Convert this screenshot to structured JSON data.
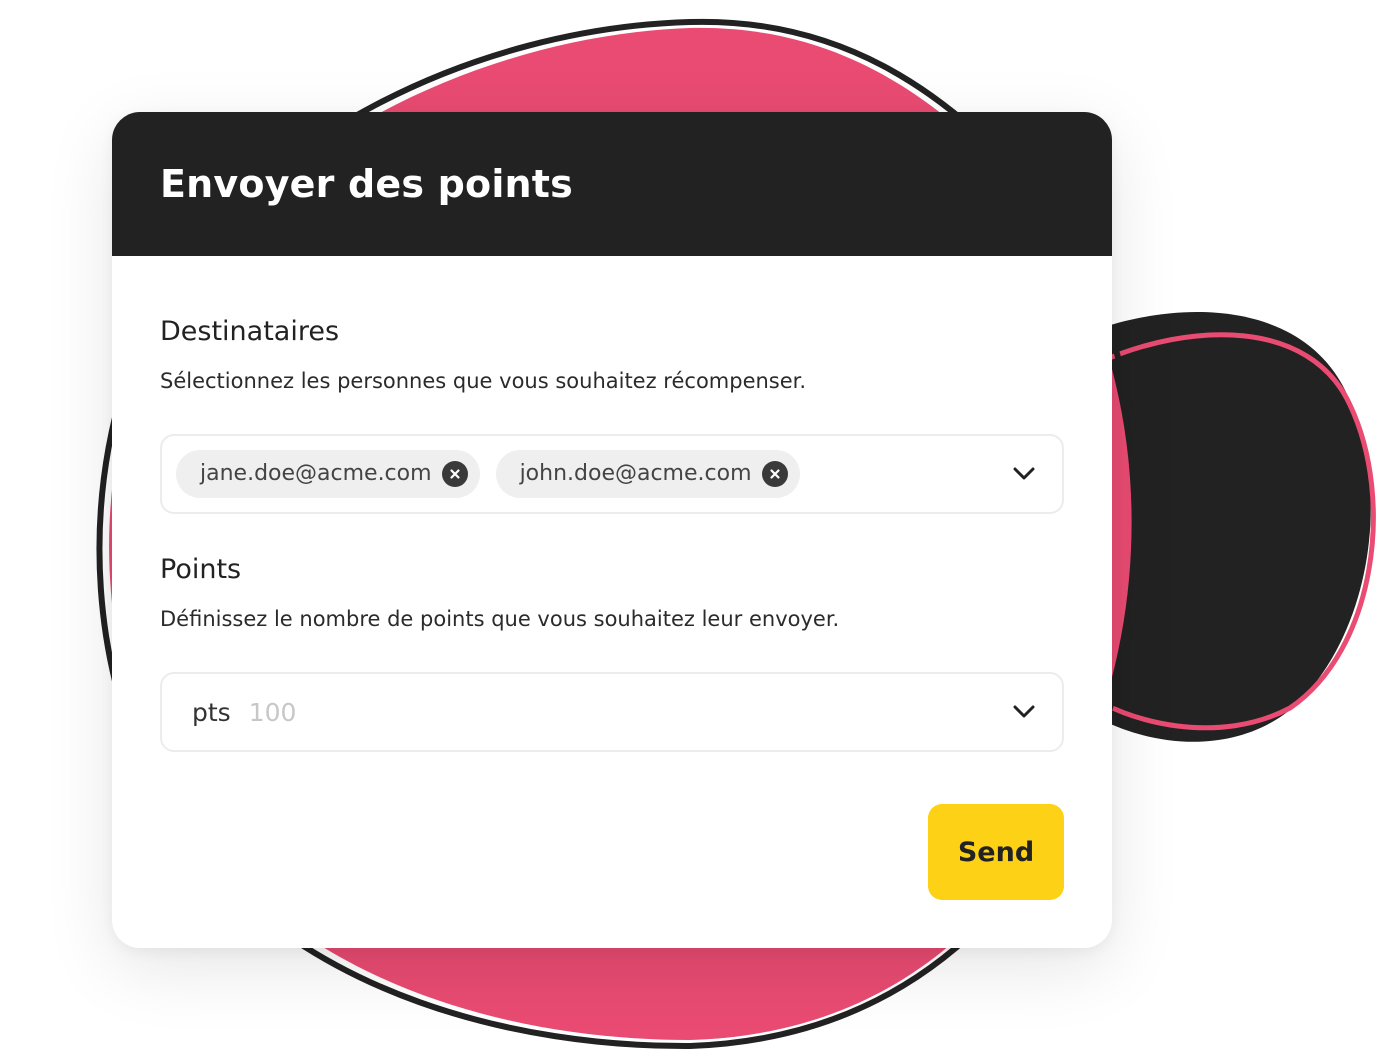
{
  "colors": {
    "header_bg": "#222222",
    "accent_pink": "#e94b72",
    "button_yellow": "#fdd216"
  },
  "header": {
    "title": "Envoyer des points"
  },
  "recipients": {
    "title": "Destinataires",
    "description": "Sélectionnez les personnes que vous souhaitez récompenser.",
    "chips": [
      {
        "label": "jane.doe@acme.com",
        "icon": "close-circle-icon"
      },
      {
        "label": "john.doe@acme.com",
        "icon": "close-circle-icon"
      }
    ],
    "dropdown_icon": "chevron-down-icon"
  },
  "points": {
    "title": "Points",
    "description": "Définissez le nombre de points que vous souhaitez leur envoyer.",
    "prefix": "pts",
    "placeholder": "100",
    "dropdown_icon": "chevron-down-icon"
  },
  "actions": {
    "send_label": "Send"
  }
}
